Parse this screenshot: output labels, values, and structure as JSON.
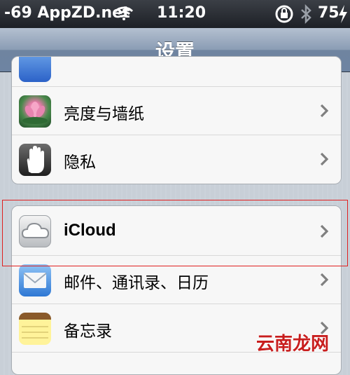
{
  "status_bar": {
    "carrier": "-69 AppZD.net",
    "time": "11:20",
    "battery": "75",
    "icons": [
      "wifi-icon",
      "rotation-lock-icon",
      "bluetooth-icon",
      "charging-bolt-icon"
    ]
  },
  "nav": {
    "title": "设置"
  },
  "groups": [
    {
      "rows": [
        {
          "label": "亮度与墙纸",
          "icon": "wallpaper-lotus-icon"
        },
        {
          "label": "隐私",
          "icon": "privacy-hand-icon"
        }
      ]
    },
    {
      "rows": [
        {
          "label": "iCloud",
          "icon": "icloud-icon"
        },
        {
          "label": "邮件、通讯录、日历",
          "icon": "mail-icon"
        },
        {
          "label": "备忘录",
          "icon": "notes-icon"
        }
      ]
    }
  ],
  "watermark": "云南龙网",
  "colors": {
    "nav_gradient_top": "#b4c0d0",
    "nav_gradient_bottom": "#6e84a2",
    "highlight_box": "#e02020",
    "watermark": "#c81e1e"
  }
}
